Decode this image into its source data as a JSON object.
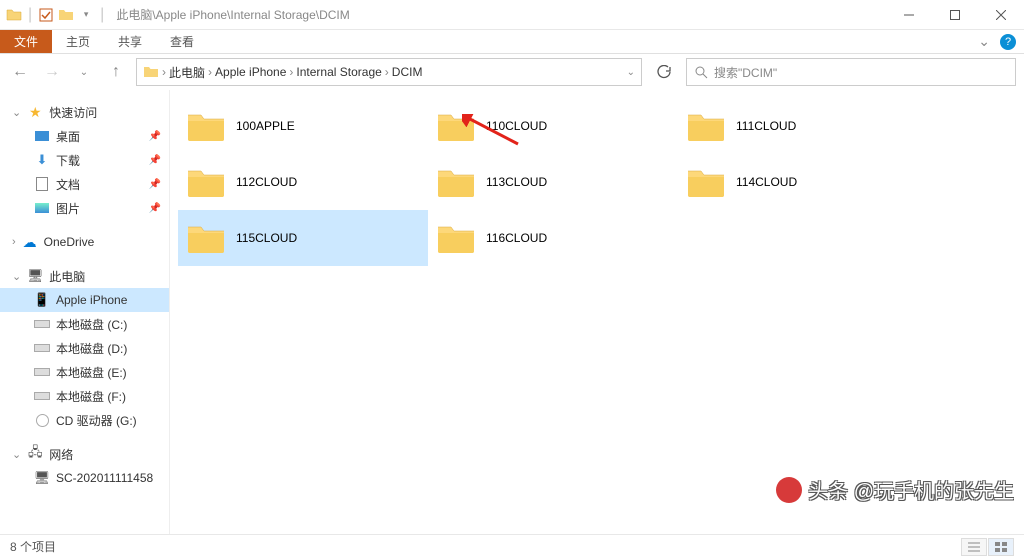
{
  "titlebar": {
    "path": "此电脑\\Apple iPhone\\Internal Storage\\DCIM"
  },
  "ribbon": {
    "file": "文件",
    "tabs": [
      "主页",
      "共享",
      "查看"
    ]
  },
  "breadcrumb": {
    "items": [
      "此电脑",
      "Apple iPhone",
      "Internal Storage",
      "DCIM"
    ]
  },
  "search": {
    "placeholder": "搜索\"DCIM\""
  },
  "sidebar": {
    "quick": {
      "label": "快速访问",
      "items": [
        {
          "label": "桌面"
        },
        {
          "label": "下载"
        },
        {
          "label": "文档"
        },
        {
          "label": "图片"
        }
      ]
    },
    "onedrive": "OneDrive",
    "thispc": {
      "label": "此电脑",
      "items": [
        {
          "label": "Apple iPhone",
          "selected": true,
          "type": "device"
        },
        {
          "label": "本地磁盘 (C:)",
          "type": "drive"
        },
        {
          "label": "本地磁盘 (D:)",
          "type": "drive"
        },
        {
          "label": "本地磁盘 (E:)",
          "type": "drive"
        },
        {
          "label": "本地磁盘 (F:)",
          "type": "drive"
        },
        {
          "label": "CD 驱动器 (G:)",
          "type": "dvd"
        }
      ]
    },
    "network": {
      "label": "网络",
      "items": [
        {
          "label": "SC-202011111458"
        }
      ]
    }
  },
  "folders": [
    {
      "name": "100APPLE"
    },
    {
      "name": "110CLOUD"
    },
    {
      "name": "111CLOUD"
    },
    {
      "name": "112CLOUD"
    },
    {
      "name": "113CLOUD"
    },
    {
      "name": "114CLOUD"
    },
    {
      "name": "115CLOUD",
      "selected": true
    },
    {
      "name": "116CLOUD"
    }
  ],
  "status": {
    "count": "8 个项目"
  },
  "watermark": "头条 @玩手机的张先生"
}
